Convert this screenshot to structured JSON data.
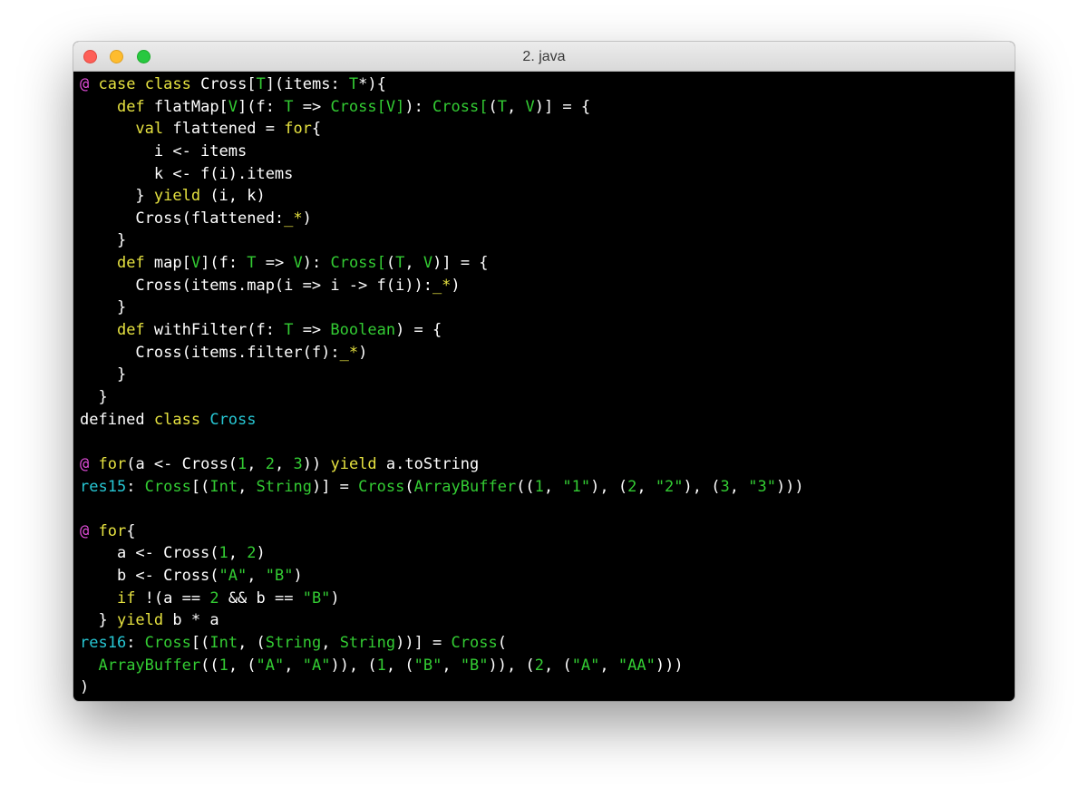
{
  "window": {
    "title": "2. java"
  },
  "colors": {
    "default": "#ffffff",
    "prompt": "#e04cd8",
    "keyword": "#e6e240",
    "type": "#33cc33",
    "result": "#27c7d4",
    "background": "#000000"
  },
  "terminal": {
    "lines": [
      [
        [
          "@",
          "prompt"
        ],
        [
          " ",
          "default"
        ],
        [
          "case",
          "keyword"
        ],
        [
          " ",
          "default"
        ],
        [
          "class",
          "keyword"
        ],
        [
          " Cross[",
          "default"
        ],
        [
          "T",
          "type"
        ],
        [
          "](items: ",
          "default"
        ],
        [
          "T",
          "type"
        ],
        [
          "*){",
          "default"
        ]
      ],
      [
        [
          "    ",
          "default"
        ],
        [
          "def",
          "keyword"
        ],
        [
          " flatMap[",
          "default"
        ],
        [
          "V",
          "type"
        ],
        [
          "](f: ",
          "default"
        ],
        [
          "T",
          "type"
        ],
        [
          " => ",
          "default"
        ],
        [
          "Cross[V]",
          "type"
        ],
        [
          "): ",
          "default"
        ],
        [
          "Cross[",
          "type"
        ],
        [
          "(",
          "default"
        ],
        [
          "T",
          "type"
        ],
        [
          ", ",
          "default"
        ],
        [
          "V",
          "type"
        ],
        [
          ")] = {",
          "default"
        ]
      ],
      [
        [
          "      ",
          "default"
        ],
        [
          "val",
          "keyword"
        ],
        [
          " flattened = ",
          "default"
        ],
        [
          "for",
          "keyword"
        ],
        [
          "{",
          "default"
        ]
      ],
      [
        [
          "        i <- items",
          "default"
        ]
      ],
      [
        [
          "        k <- f(i).items",
          "default"
        ]
      ],
      [
        [
          "      } ",
          "default"
        ],
        [
          "yield",
          "keyword"
        ],
        [
          " (i, k)",
          "default"
        ]
      ],
      [
        [
          "      Cross(flattened:",
          "default"
        ],
        [
          "_*",
          "keyword"
        ],
        [
          ")",
          "default"
        ]
      ],
      [
        [
          "    }",
          "default"
        ]
      ],
      [
        [
          "    ",
          "default"
        ],
        [
          "def",
          "keyword"
        ],
        [
          " map[",
          "default"
        ],
        [
          "V",
          "type"
        ],
        [
          "](f: ",
          "default"
        ],
        [
          "T",
          "type"
        ],
        [
          " => ",
          "default"
        ],
        [
          "V",
          "type"
        ],
        [
          "): ",
          "default"
        ],
        [
          "Cross[",
          "type"
        ],
        [
          "(",
          "default"
        ],
        [
          "T",
          "type"
        ],
        [
          ", ",
          "default"
        ],
        [
          "V",
          "type"
        ],
        [
          ")] = {",
          "default"
        ]
      ],
      [
        [
          "      Cross(items.map(i => i -> f(i)):",
          "default"
        ],
        [
          "_*",
          "keyword"
        ],
        [
          ")",
          "default"
        ]
      ],
      [
        [
          "    }",
          "default"
        ]
      ],
      [
        [
          "    ",
          "default"
        ],
        [
          "def",
          "keyword"
        ],
        [
          " withFilter(f: ",
          "default"
        ],
        [
          "T",
          "type"
        ],
        [
          " => ",
          "default"
        ],
        [
          "Boolean",
          "type"
        ],
        [
          ") = {",
          "default"
        ]
      ],
      [
        [
          "      Cross(items.filter(f):",
          "default"
        ],
        [
          "_*",
          "keyword"
        ],
        [
          ")",
          "default"
        ]
      ],
      [
        [
          "    }",
          "default"
        ]
      ],
      [
        [
          "  }",
          "default"
        ]
      ],
      [
        [
          "defined ",
          "default"
        ],
        [
          "class",
          "keyword"
        ],
        [
          " ",
          "default"
        ],
        [
          "Cross",
          "result"
        ]
      ],
      [
        [
          "",
          "default"
        ]
      ],
      [
        [
          "@",
          "prompt"
        ],
        [
          " ",
          "default"
        ],
        [
          "for",
          "keyword"
        ],
        [
          "(a <- Cross(",
          "default"
        ],
        [
          "1",
          "type"
        ],
        [
          ", ",
          "default"
        ],
        [
          "2",
          "type"
        ],
        [
          ", ",
          "default"
        ],
        [
          "3",
          "type"
        ],
        [
          ")) ",
          "default"
        ],
        [
          "yield",
          "keyword"
        ],
        [
          " a.toString",
          "default"
        ]
      ],
      [
        [
          "res15",
          "result"
        ],
        [
          ": ",
          "default"
        ],
        [
          "Cross",
          "type"
        ],
        [
          "[(",
          "default"
        ],
        [
          "Int",
          "type"
        ],
        [
          ", ",
          "default"
        ],
        [
          "String",
          "type"
        ],
        [
          ")] = ",
          "default"
        ],
        [
          "Cross",
          "type"
        ],
        [
          "(",
          "default"
        ],
        [
          "ArrayBuffer",
          "type"
        ],
        [
          "((",
          "default"
        ],
        [
          "1",
          "type"
        ],
        [
          ", ",
          "default"
        ],
        [
          "\"1\"",
          "type"
        ],
        [
          "), (",
          "default"
        ],
        [
          "2",
          "type"
        ],
        [
          ", ",
          "default"
        ],
        [
          "\"2\"",
          "type"
        ],
        [
          "), (",
          "default"
        ],
        [
          "3",
          "type"
        ],
        [
          ", ",
          "default"
        ],
        [
          "\"3\"",
          "type"
        ],
        [
          ")))",
          "default"
        ]
      ],
      [
        [
          "",
          "default"
        ]
      ],
      [
        [
          "@",
          "prompt"
        ],
        [
          " ",
          "default"
        ],
        [
          "for",
          "keyword"
        ],
        [
          "{",
          "default"
        ]
      ],
      [
        [
          "    a <- Cross(",
          "default"
        ],
        [
          "1",
          "type"
        ],
        [
          ", ",
          "default"
        ],
        [
          "2",
          "type"
        ],
        [
          ")",
          "default"
        ]
      ],
      [
        [
          "    b <- Cross(",
          "default"
        ],
        [
          "\"A\"",
          "type"
        ],
        [
          ", ",
          "default"
        ],
        [
          "\"B\"",
          "type"
        ],
        [
          ")",
          "default"
        ]
      ],
      [
        [
          "    ",
          "default"
        ],
        [
          "if",
          "keyword"
        ],
        [
          " !(a == ",
          "default"
        ],
        [
          "2",
          "type"
        ],
        [
          " && b == ",
          "default"
        ],
        [
          "\"B\"",
          "type"
        ],
        [
          ")",
          "default"
        ]
      ],
      [
        [
          "  } ",
          "default"
        ],
        [
          "yield",
          "keyword"
        ],
        [
          " b * a",
          "default"
        ]
      ],
      [
        [
          "res16",
          "result"
        ],
        [
          ": ",
          "default"
        ],
        [
          "Cross",
          "type"
        ],
        [
          "[(",
          "default"
        ],
        [
          "Int",
          "type"
        ],
        [
          ", (",
          "default"
        ],
        [
          "String",
          "type"
        ],
        [
          ", ",
          "default"
        ],
        [
          "String",
          "type"
        ],
        [
          "))] = ",
          "default"
        ],
        [
          "Cross",
          "type"
        ],
        [
          "(",
          "default"
        ]
      ],
      [
        [
          "  ",
          "default"
        ],
        [
          "ArrayBuffer",
          "type"
        ],
        [
          "((",
          "default"
        ],
        [
          "1",
          "type"
        ],
        [
          ", (",
          "default"
        ],
        [
          "\"A\"",
          "type"
        ],
        [
          ", ",
          "default"
        ],
        [
          "\"A\"",
          "type"
        ],
        [
          ")), (",
          "default"
        ],
        [
          "1",
          "type"
        ],
        [
          ", (",
          "default"
        ],
        [
          "\"B\"",
          "type"
        ],
        [
          ", ",
          "default"
        ],
        [
          "\"B\"",
          "type"
        ],
        [
          ")), (",
          "default"
        ],
        [
          "2",
          "type"
        ],
        [
          ", (",
          "default"
        ],
        [
          "\"A\"",
          "type"
        ],
        [
          ", ",
          "default"
        ],
        [
          "\"AA\"",
          "type"
        ],
        [
          ")))",
          "default"
        ]
      ],
      [
        [
          ")",
          "default"
        ]
      ]
    ]
  }
}
